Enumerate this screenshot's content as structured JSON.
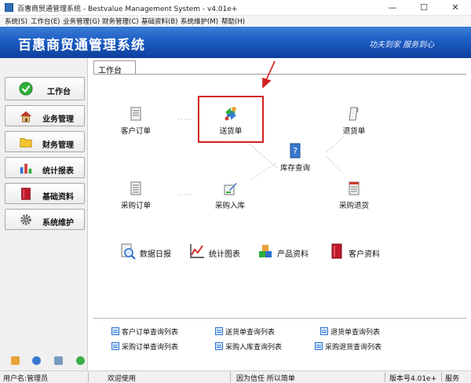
{
  "window": {
    "title": "百惠商贸通管理系统 - Bestvalue Management System - v4.01e+",
    "controls": {
      "minimize": "—",
      "maximize": "☐",
      "close": "✕"
    }
  },
  "menu": [
    "系统(S)",
    "工作台(E)",
    "业务管理(G)",
    "财务管理(C)",
    "基础资料(B)",
    "系统维护(M)",
    "帮助(H)"
  ],
  "banner": {
    "app_name": "百惠商贸通管理系统",
    "slogan": "功夫到家  服务到心"
  },
  "sidebar": {
    "items": [
      {
        "label": "工作台",
        "icon": "check-icon"
      },
      {
        "label": "业务管理",
        "icon": "house-icon"
      },
      {
        "label": "财务管理",
        "icon": "folder-icon"
      },
      {
        "label": "统计报表",
        "icon": "bar-chart-icon"
      },
      {
        "label": "基础资料",
        "icon": "book-icon"
      },
      {
        "label": "系统维护",
        "icon": "gear-icon"
      }
    ]
  },
  "workspace": {
    "tab": "工作台",
    "nodes": {
      "customer_order": "客户订单",
      "delivery": "送货单",
      "return": "退货单",
      "inventory": "库存查询",
      "purchase_order": "采购订单",
      "purchase_in": "采购入库",
      "purchase_return": "采购退货"
    },
    "tools": {
      "daily_report": "数据日报",
      "stats_chart": "统计图表",
      "product_info": "产品资料",
      "customer_info": "客户资料"
    },
    "queries": [
      "客户订单查询列表",
      "送货单查询列表",
      "退货单查询列表",
      "采购订单查询列表",
      "采购入库查询列表",
      "采购退货查询列表"
    ]
  },
  "status": {
    "user": "用户名:管理员",
    "welcome": "欢迎使用",
    "motto": "因为信任 所以简单",
    "version": "版本号4.01e+",
    "service": "服务"
  },
  "colors": {
    "banner_top": "#3d7fd6",
    "banner_bottom": "#0f3f9c",
    "highlight": "#d42020"
  }
}
